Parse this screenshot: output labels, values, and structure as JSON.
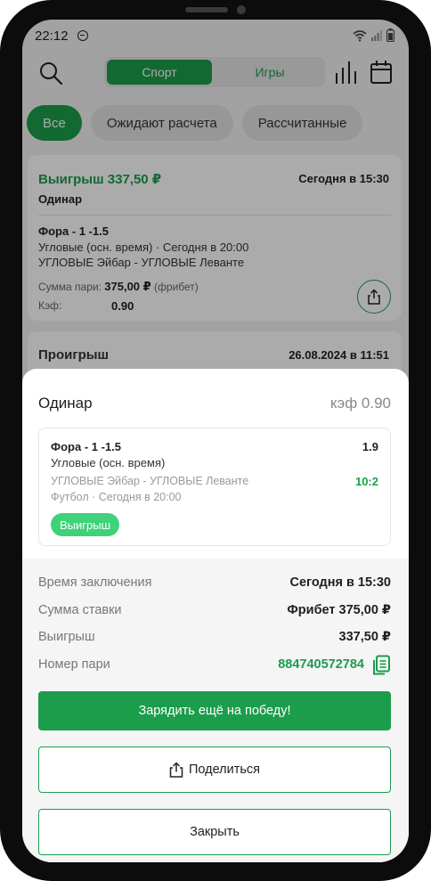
{
  "status_bar": {
    "time": "22:12"
  },
  "topbar": {
    "tabs": [
      {
        "label": "Спорт",
        "active": true
      },
      {
        "label": "Игры",
        "active": false
      }
    ]
  },
  "filters": [
    {
      "label": "Все",
      "active": true
    },
    {
      "label": "Ожидают расчета",
      "active": false
    },
    {
      "label": "Рассчитанные",
      "active": false
    }
  ],
  "bets_list": [
    {
      "status": "Выигрыш 337,50 ₽",
      "date": "Сегодня в 15:30",
      "type": "Одинар",
      "outcome": "Фора - 1 -1.5",
      "market_line": "Угловые (осн. время) · Сегодня в 20:00",
      "event": "УГЛОВЫЕ Эйбар - УГЛОВЫЕ Леванте",
      "sum_label": "Сумма пари:",
      "sum_value": "375,00 ₽",
      "sum_note": "(фрибет)",
      "kef_label": "Кэф:",
      "kef_value": "0.90"
    },
    {
      "status": "Проигрыш",
      "date": "26.08.2024 в 11:51"
    }
  ],
  "sheet": {
    "title": "Одинар",
    "kef": "кэф 0.90",
    "bet": {
      "outcome": "Фора - 1 -1.5",
      "odds": "1.9",
      "market": "Угловые (осн. время)",
      "event": "УГЛОВЫЕ Эйбар - УГЛОВЫЕ Леванте",
      "score": "10:2",
      "sport_time": "Футбол · Сегодня в 20:00",
      "badge": "Выигрыш"
    },
    "details": {
      "time_label": "Время заключения",
      "time_value": "Сегодня в 15:30",
      "stake_label": "Сумма ставки",
      "stake_value": "Фрибет 375,00 ₽",
      "win_label": "Выигрыш",
      "win_value": "337,50 ₽",
      "number_label": "Номер пари",
      "number_value": "884740572784"
    },
    "buttons": {
      "again": "Зарядить ещё на победу!",
      "share": "Поделиться",
      "close": "Закрыть"
    }
  },
  "colors": {
    "accent": "#1b9d4b",
    "badge": "#3fd27a"
  },
  "icons": [
    "search-icon",
    "stats-icon",
    "calendar-icon",
    "share-icon",
    "copy-icon",
    "wifi-icon",
    "signal-icon",
    "battery-icon",
    "dnd-icon"
  ]
}
